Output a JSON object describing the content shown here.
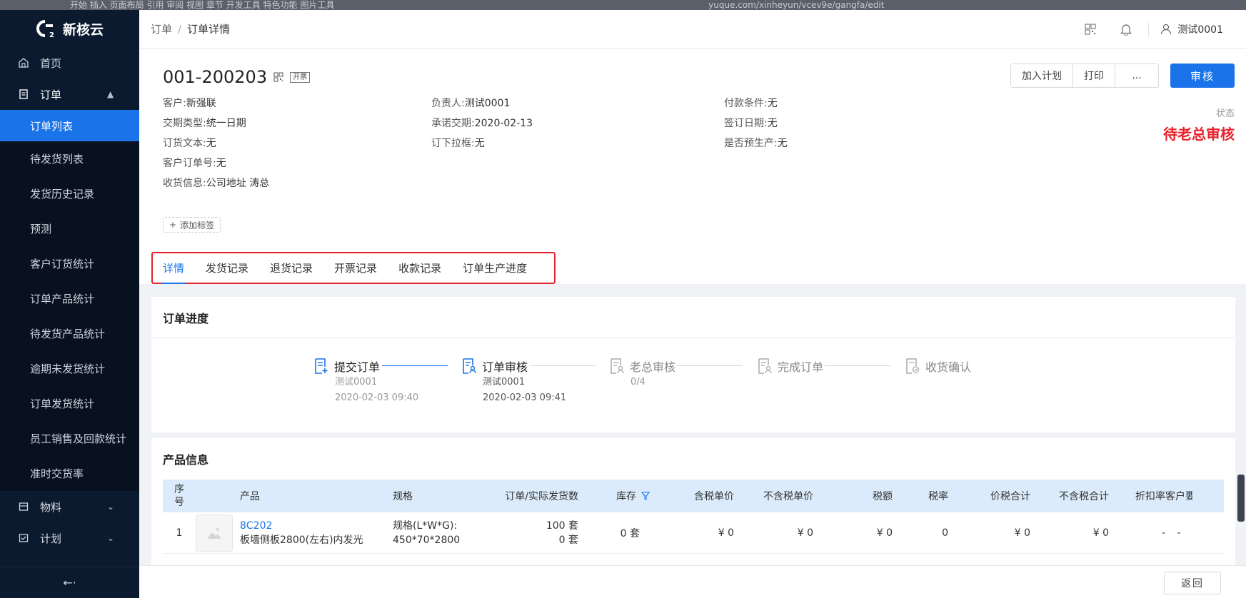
{
  "browser": {
    "toolbar_text": "开始 插入 页面布局 引用 审阅 视图 章节 开发工具 特色功能 图片工具",
    "url_text": "yuque.com/xinheyun/vcev9e/gangfa/edit"
  },
  "app": {
    "name": "新核云"
  },
  "sidebar": {
    "home": "首页",
    "order": "订单",
    "order_children": [
      "订单列表",
      "待发货列表",
      "发货历史记录",
      "预测",
      "客户订货统计",
      "订单产品统计",
      "待发货产品统计",
      "逾期未发货统计",
      "订单发货统计",
      "员工销售及回款统计",
      "准时交货率"
    ],
    "material": "物料",
    "plan": "计划",
    "collapse_icon": "←·"
  },
  "header": {
    "breadcrumb": [
      "订单",
      "订单详情"
    ],
    "user": "测试0001"
  },
  "order": {
    "number": "001-200203",
    "open_tag": "开票",
    "fields": {
      "customer": {
        "k": "客户:",
        "v": "新强联"
      },
      "owner": {
        "k": "负责人:",
        "v": "测试0001"
      },
      "payment": {
        "k": "付款条件:",
        "v": "无"
      },
      "delivery_type": {
        "k": "交期类型:",
        "v": "统一日期"
      },
      "promise_date": {
        "k": "承诺交期:",
        "v": "2020-02-13"
      },
      "sign_date": {
        "k": "签订日期:",
        "v": "无"
      },
      "order_text": {
        "k": "订货文本:",
        "v": "无"
      },
      "dropdown": {
        "k": "订下拉框:",
        "v": "无"
      },
      "pre_produce": {
        "k": "是否预生产:",
        "v": "无"
      },
      "customer_order_no": {
        "k": "客户订单号:",
        "v": "无"
      },
      "receive_info": {
        "k": "收货信息:",
        "v": "公司地址 涛总"
      }
    },
    "status_label": "状态",
    "status_value": "待老总审核",
    "add_tag": "添加标签"
  },
  "actions": {
    "add_plan": "加入计划",
    "print": "打印",
    "more": "...",
    "approve": "审核"
  },
  "tabs": [
    "详情",
    "发货记录",
    "退货记录",
    "开票记录",
    "收款记录",
    "订单生产进度"
  ],
  "progress": {
    "title": "订单进度",
    "steps": [
      {
        "label": "提交订单",
        "user": "测试0001",
        "time": "2020-02-03 09:40"
      },
      {
        "label": "订单审核",
        "user": "测试0001",
        "time": "2020-02-03 09:41"
      },
      {
        "label": "老总审核",
        "user": "0/4",
        "time": ""
      },
      {
        "label": "完成订单",
        "user": "",
        "time": ""
      },
      {
        "label": "收货确认",
        "user": "",
        "time": ""
      }
    ]
  },
  "products": {
    "title": "产品信息",
    "columns": [
      "序号",
      "产品",
      "规格",
      "订单/实际发货数",
      "库存",
      "含税单价",
      "不含税单价",
      "税额",
      "税率",
      "价税合计",
      "不含税合计",
      "折扣率",
      "客户要"
    ],
    "rows": [
      {
        "idx": "1",
        "code": "8C202",
        "name": "板墙侧板2800(左右)内发光",
        "spec_line1": "规格(L*W*G):",
        "spec_line2": "450*70*2800",
        "ordered": "100 套",
        "shipped": "0 套",
        "stock": "0 套",
        "price_tax": "¥ 0",
        "price_notax": "¥ 0",
        "tax": "¥ 0",
        "tax_rate": "0",
        "total_tax": "¥ 0",
        "total_notax": "¥ 0",
        "discount": "-",
        "customer_req": "-"
      }
    ]
  },
  "footer": {
    "back": "返回"
  },
  "colors": {
    "primary": "#1a73e8",
    "status_red": "#e8212b",
    "sidebar_bg": "#0b1a2e"
  }
}
